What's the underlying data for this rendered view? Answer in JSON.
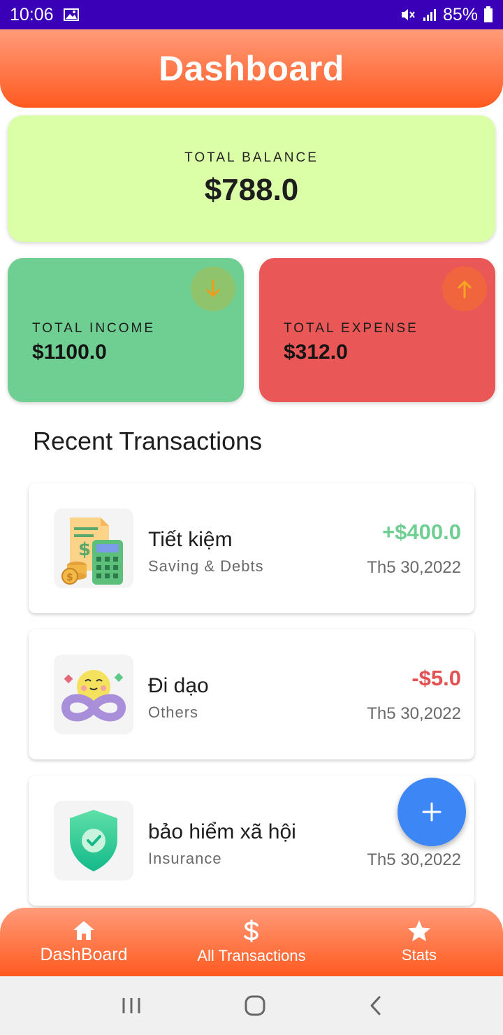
{
  "status_bar": {
    "time": "10:06",
    "battery": "85%"
  },
  "header": {
    "title": "Dashboard"
  },
  "balance": {
    "label": "TOTAL BALANCE",
    "value": "$788.0"
  },
  "income": {
    "label": "TOTAL INCOME",
    "value": "$1100.0"
  },
  "expense": {
    "label": "TOTAL EXPENSE",
    "value": "$312.0"
  },
  "recent": {
    "title": "Recent Transactions",
    "items": [
      {
        "name": "Tiết kiệm",
        "category": "Saving & Debts",
        "amount": "+$400.0",
        "amount_color": "#6fcf93",
        "date": "Th5 30,2022"
      },
      {
        "name": "Đi dạo",
        "category": "Others",
        "amount": "-$5.0",
        "amount_color": "#e35252",
        "date": "Th5 30,2022"
      },
      {
        "name": "bảo hiểm xã hội",
        "category": "Insurance",
        "amount": "",
        "amount_color": "#e35252",
        "date": "Th5 30,2022"
      }
    ]
  },
  "fab": {
    "icon": "plus-icon",
    "label": "+"
  },
  "bottom_nav": [
    {
      "label": "DashBoard",
      "icon": "home-icon"
    },
    {
      "label": "All Transactions",
      "icon": "dollar-icon"
    },
    {
      "label": "Stats",
      "icon": "star-icon"
    }
  ]
}
